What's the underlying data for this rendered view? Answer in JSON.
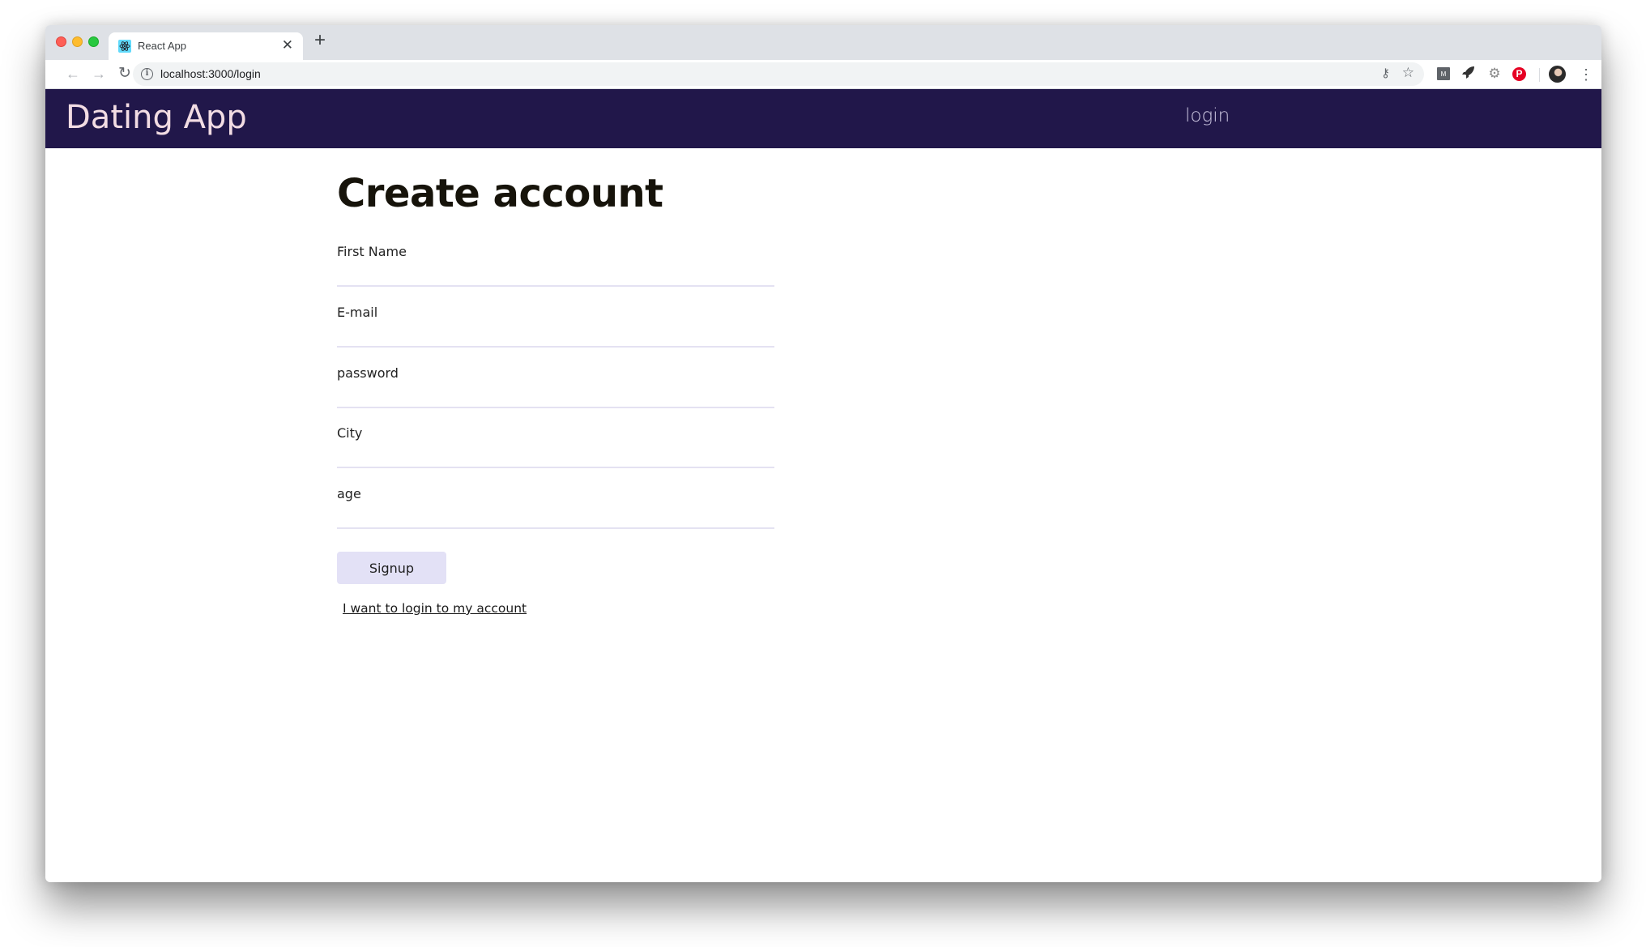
{
  "browser": {
    "tab": {
      "title": "React App",
      "favicon": "react-logo-icon",
      "close_glyph": "✕"
    },
    "new_tab_glyph": "+",
    "nav": {
      "back_glyph": "←",
      "forward_glyph": "→",
      "reload_glyph": "↻"
    },
    "url": "localhost:3000/login",
    "info_glyph": "i",
    "key_glyph": "⚷",
    "star_glyph": "☆",
    "extensions": [
      {
        "name": "m-extension-icon",
        "glyph": "M"
      },
      {
        "name": "rocket-extension-icon",
        "glyph": "🚀"
      },
      {
        "name": "gear-extension-icon",
        "glyph": "⚙"
      },
      {
        "name": "pinterest-extension-icon",
        "glyph": "P"
      }
    ],
    "menu_glyph": "⋮"
  },
  "header": {
    "logo": "Dating App",
    "nav_login": "login",
    "colors": {
      "background": "#21174a",
      "logo": "#f2dce3"
    }
  },
  "form": {
    "title": "Create account",
    "fields": [
      {
        "label": "First Name",
        "value": "",
        "type": "text"
      },
      {
        "label": "E-mail",
        "value": "",
        "type": "email"
      },
      {
        "label": "password",
        "value": "",
        "type": "password"
      },
      {
        "label": "City",
        "value": "",
        "type": "text"
      },
      {
        "label": "age",
        "value": "",
        "type": "number"
      }
    ],
    "submit_label": "Signup",
    "login_link": "I want to login to my account"
  }
}
